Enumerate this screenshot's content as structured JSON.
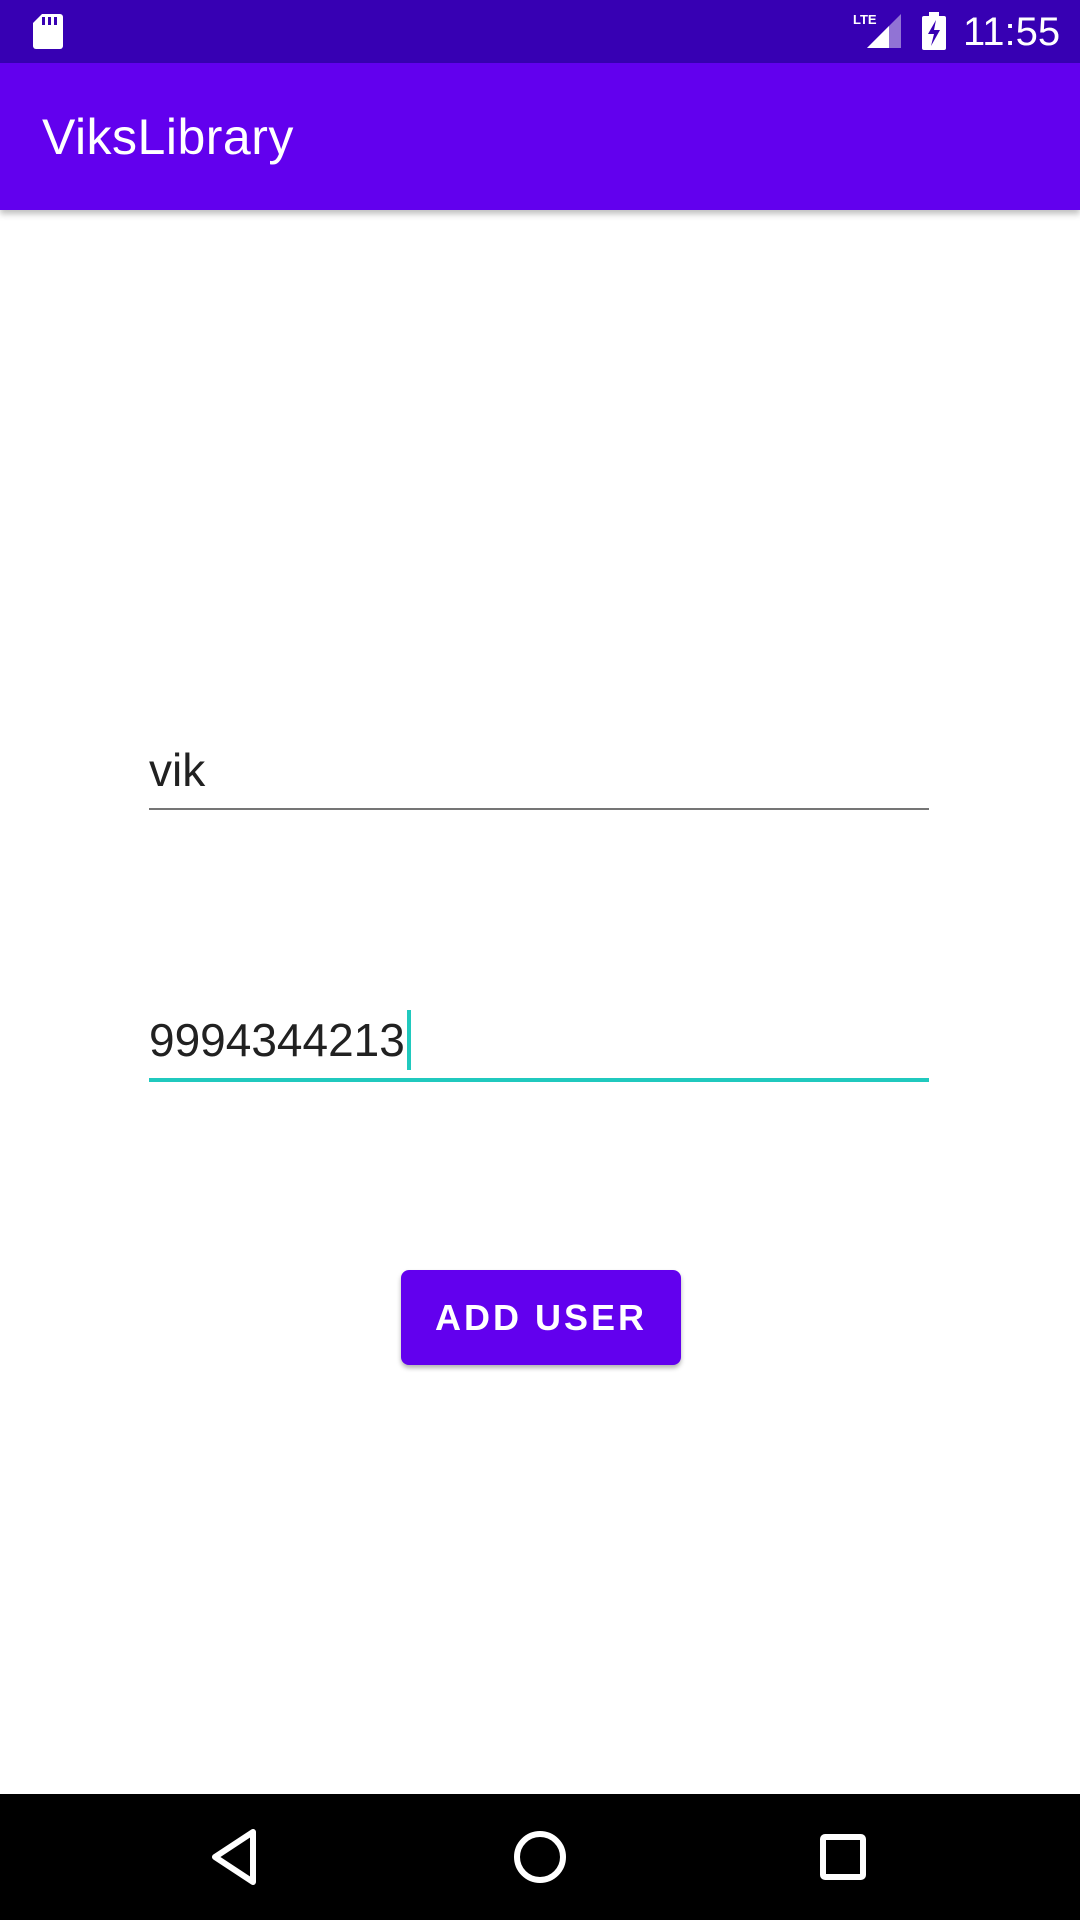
{
  "status_bar": {
    "time": "11:55",
    "network_label": "LTE",
    "icons": [
      "sd-card-icon",
      "lte-signal-icon",
      "battery-charging-icon"
    ]
  },
  "app_bar": {
    "title": "ViksLibrary"
  },
  "form": {
    "name_value": "vik",
    "phone_value": "9994344213",
    "add_button_label": "ADD USER"
  },
  "nav_bar": {
    "icons": [
      "back-icon",
      "home-icon",
      "recents-icon"
    ]
  },
  "colors": {
    "status_bar": "#3700B3",
    "primary": "#6200EE",
    "focus_accent": "#20C9BE",
    "nav_bar": "#000000"
  }
}
